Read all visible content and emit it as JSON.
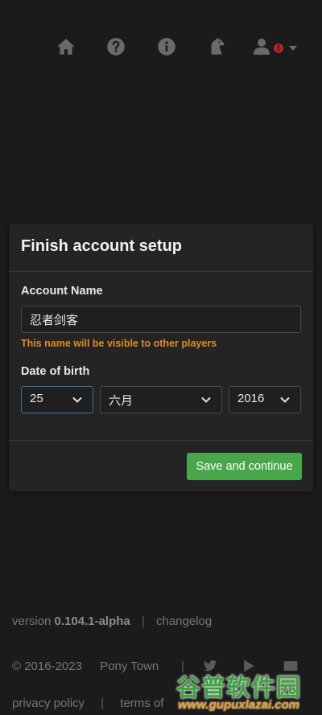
{
  "nav": {
    "icons": [
      "home-icon",
      "help-icon",
      "info-icon",
      "horse-icon",
      "user-icon"
    ],
    "alert_badge": "!"
  },
  "modal": {
    "title": "Finish account setup",
    "account_name_label": "Account Name",
    "account_name_value": "忍者剑客",
    "account_name_hint": "This name will be visible to other players",
    "dob_label": "Date of birth",
    "day": "25",
    "month": "六月",
    "year": "2016",
    "save_button": "Save and continue"
  },
  "footer": {
    "version_prefix": "version",
    "version_number": "0.104.1-alpha",
    "separator": "|",
    "changelog": "changelog",
    "copyright": "© 2016-2023",
    "pony_town": "Pony Town",
    "privacy_policy": "privacy policy",
    "terms": "terms of"
  },
  "watermark": {
    "big": "谷普软件园",
    "small": "www.gupuxlazai.com"
  },
  "colors": {
    "background": "#1b1b1b",
    "modal": "#242424",
    "save": "#4aa64a",
    "hint": "#e08a25",
    "alert": "#b52427"
  }
}
